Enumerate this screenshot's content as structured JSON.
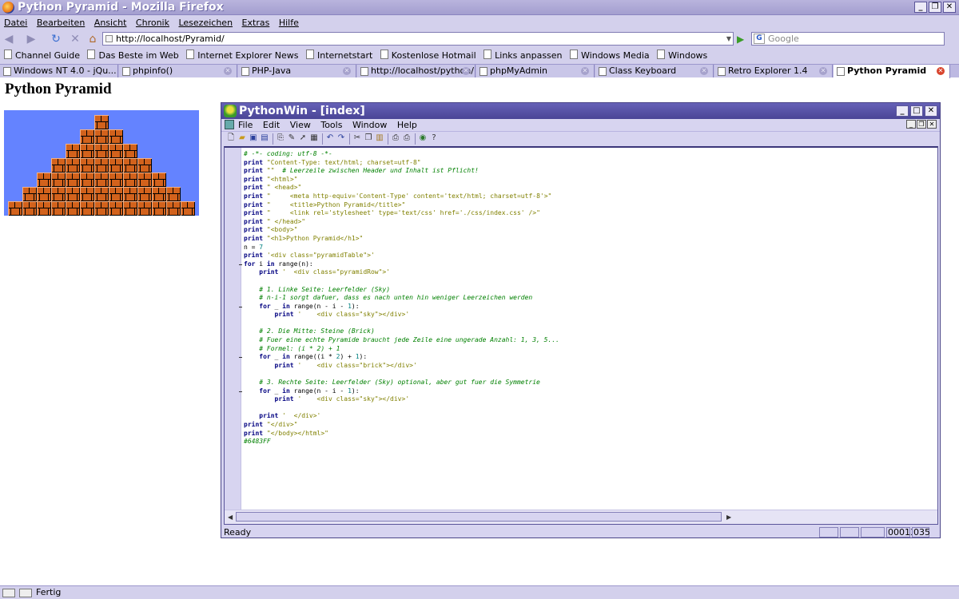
{
  "firefox": {
    "title": "Python Pyramid - Mozilla Firefox",
    "menu": [
      "Datei",
      "Bearbeiten",
      "Ansicht",
      "Chronik",
      "Lesezeichen",
      "Extras",
      "Hilfe"
    ],
    "url": "http://localhost/Pyramid/",
    "search_placeholder": "Google",
    "bookmarks": [
      "Channel Guide",
      "Das Beste im Web",
      "Internet Explorer News",
      "Internetstart",
      "Kostenlose Hotmail",
      "Links anpassen",
      "Windows Media",
      "Windows"
    ],
    "tabs": [
      "Windows NT 4.0 - jQu...",
      "phpinfo()",
      "PHP-Java",
      "http://localhost/python/",
      "phpMyAdmin",
      "Class Keyboard",
      "Retro Explorer 1.4",
      "Python Pyramid"
    ],
    "status": "Fertig"
  },
  "page": {
    "heading": "Python Pyramid",
    "pyramid_rows": 7,
    "sky_color": "#6483FF",
    "brick_color": "#D2621C"
  },
  "pythonwin": {
    "title": "PythonWin - [index]",
    "menu": [
      "File",
      "Edit",
      "View",
      "Tools",
      "Window",
      "Help"
    ],
    "status_ready": "Ready",
    "status_line": "00013",
    "status_col": "035",
    "code_lines": [
      "# -*- coding: utf-8 -*-",
      "print \"Content-Type: text/html; charset=utf-8\"",
      "print \"\"  # Leerzeile zwischen Header und Inhalt ist Pflicht!",
      "print \"<html>\"",
      "print \" <head>\"",
      "print \"     <meta http-equiv='Content-Type' content='text/html; charset=utf-8'>\"",
      "print \"     <title>Python Pyramid</title>\"",
      "print \"     <link rel='stylesheet' type='text/css' href='./css/index.css' />\"",
      "print \" </head>\"",
      "print \"<body>\"",
      "print \"<h1>Python Pyramid</h1>\"",
      "n = 7",
      "print '<div class=\"pyramidTable\">'",
      "for i in range(n):",
      "    print '  <div class=\"pyramidRow\">'",
      "",
      "    # 1. Linke Seite: Leerfelder (Sky)",
      "    # n-i-1 sorgt dafuer, dass es nach unten hin weniger Leerzeichen werden",
      "    for _ in range(n - i - 1):",
      "        print '    <div class=\"sky\"></div>'",
      "",
      "    # 2. Die Mitte: Steine (Brick)",
      "    # Fuer eine echte Pyramide braucht jede Zeile eine ungerade Anzahl: 1, 3, 5...",
      "    # Formel: (i * 2) + 1",
      "    for _ in range((i * 2) + 1):",
      "        print '    <div class=\"brick\"></div>'",
      "",
      "    # 3. Rechte Seite: Leerfelder (Sky) optional, aber gut fuer die Symmetrie",
      "    for _ in range(n - i - 1):",
      "        print '    <div class=\"sky\"></div>'",
      "",
      "    print '  </div>'",
      "print \"</div>\"",
      "print \"</body></html>\"",
      "#6483FF"
    ]
  }
}
